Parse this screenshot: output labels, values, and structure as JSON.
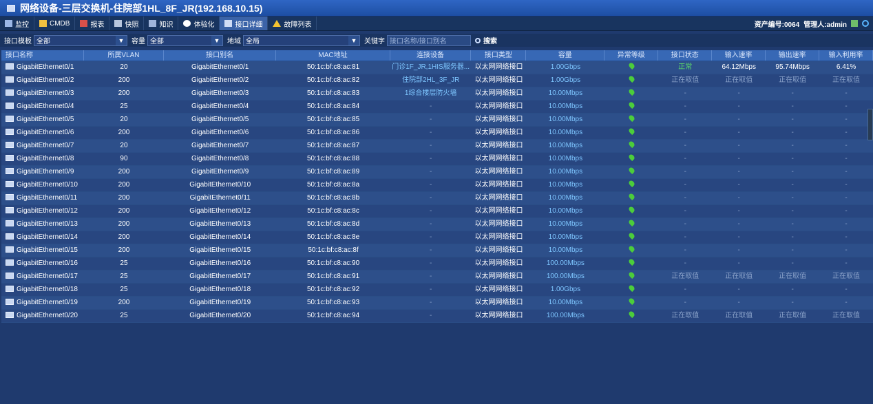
{
  "window": {
    "title": "网络设备-三层交换机-住院部1HL_8F_JR(192.168.10.15)"
  },
  "tabs": [
    {
      "label": "监控",
      "icon": "monitor-icon"
    },
    {
      "label": "CMDB",
      "icon": "cmdb-icon"
    },
    {
      "label": "报表",
      "icon": "report-icon"
    },
    {
      "label": "快照",
      "icon": "snapshot-icon"
    },
    {
      "label": "知识",
      "icon": "knowledge-icon"
    },
    {
      "label": "体验化",
      "icon": "experience-icon"
    },
    {
      "label": "接口详细",
      "icon": "interface-icon",
      "active": true
    },
    {
      "label": "故障列表",
      "icon": "warning-icon"
    }
  ],
  "header_right": {
    "asset_label": "资产编号:0064",
    "admin_label": "管理人:admin"
  },
  "filters": {
    "template_label": "接口模板",
    "template_value": "全部",
    "capacity_label": "容量",
    "capacity_value": "全部",
    "region_label": "地域",
    "region_value": "全局",
    "keyword_label": "关键字",
    "keyword_placeholder": "接口名称/接口别名",
    "search_label": "搜索"
  },
  "columns": [
    "接口名称",
    "所属VLAN",
    "接口别名",
    "MAC地址",
    "连接设备",
    "接口类型",
    "容量",
    "异常等级",
    "接口状态",
    "输入速率",
    "输出速率",
    "输入利用率"
  ],
  "rows": [
    {
      "name": "GigabitEthernet0/1",
      "vlan": "20",
      "alias": "GigabitEthernet0/1",
      "mac": "50:1c:bf:c8:ac:81",
      "device": "门诊1F_JR,1HIS服务器...",
      "type": "以太网网络接口",
      "cap": "1.00Gbps",
      "status": "正常",
      "in": "64.12Mbps",
      "out": "95.74Mbps",
      "util": "6.41%"
    },
    {
      "name": "GigabitEthernet0/2",
      "vlan": "200",
      "alias": "GigabitEthernet0/2",
      "mac": "50:1c:bf:c8:ac:82",
      "device": "住院部2HL_3F_JR",
      "type": "以太网网络接口",
      "cap": "1.00Gbps",
      "status": "正在取值",
      "in": "正在取值",
      "out": "正在取值",
      "util": "正在取值"
    },
    {
      "name": "GigabitEthernet0/3",
      "vlan": "200",
      "alias": "GigabitEthernet0/3",
      "mac": "50:1c:bf:c8:ac:83",
      "device": "1综合楼层防火墙",
      "type": "以太网网络接口",
      "cap": "10.00Mbps",
      "status": "-",
      "in": "-",
      "out": "-",
      "util": "-"
    },
    {
      "name": "GigabitEthernet0/4",
      "vlan": "25",
      "alias": "GigabitEthernet0/4",
      "mac": "50:1c:bf:c8:ac:84",
      "device": "-",
      "type": "以太网网络接口",
      "cap": "10.00Mbps",
      "status": "-",
      "in": "-",
      "out": "-",
      "util": "-"
    },
    {
      "name": "GigabitEthernet0/5",
      "vlan": "20",
      "alias": "GigabitEthernet0/5",
      "mac": "50:1c:bf:c8:ac:85",
      "device": "-",
      "type": "以太网网络接口",
      "cap": "10.00Mbps",
      "status": "-",
      "in": "-",
      "out": "-",
      "util": "-"
    },
    {
      "name": "GigabitEthernet0/6",
      "vlan": "200",
      "alias": "GigabitEthernet0/6",
      "mac": "50:1c:bf:c8:ac:86",
      "device": "-",
      "type": "以太网网络接口",
      "cap": "10.00Mbps",
      "status": "-",
      "in": "-",
      "out": "-",
      "util": "-"
    },
    {
      "name": "GigabitEthernet0/7",
      "vlan": "20",
      "alias": "GigabitEthernet0/7",
      "mac": "50:1c:bf:c8:ac:87",
      "device": "-",
      "type": "以太网网络接口",
      "cap": "10.00Mbps",
      "status": "-",
      "in": "-",
      "out": "-",
      "util": "-"
    },
    {
      "name": "GigabitEthernet0/8",
      "vlan": "90",
      "alias": "GigabitEthernet0/8",
      "mac": "50:1c:bf:c8:ac:88",
      "device": "-",
      "type": "以太网网络接口",
      "cap": "10.00Mbps",
      "status": "-",
      "in": "-",
      "out": "-",
      "util": "-"
    },
    {
      "name": "GigabitEthernet0/9",
      "vlan": "200",
      "alias": "GigabitEthernet0/9",
      "mac": "50:1c:bf:c8:ac:89",
      "device": "-",
      "type": "以太网网络接口",
      "cap": "10.00Mbps",
      "status": "-",
      "in": "-",
      "out": "-",
      "util": "-"
    },
    {
      "name": "GigabitEthernet0/10",
      "vlan": "200",
      "alias": "GigabitEthernet0/10",
      "mac": "50:1c:bf:c8:ac:8a",
      "device": "-",
      "type": "以太网网络接口",
      "cap": "10.00Mbps",
      "status": "-",
      "in": "-",
      "out": "-",
      "util": "-"
    },
    {
      "name": "GigabitEthernet0/11",
      "vlan": "200",
      "alias": "GigabitEthernet0/11",
      "mac": "50:1c:bf:c8:ac:8b",
      "device": "-",
      "type": "以太网网络接口",
      "cap": "10.00Mbps",
      "status": "-",
      "in": "-",
      "out": "-",
      "util": "-"
    },
    {
      "name": "GigabitEthernet0/12",
      "vlan": "200",
      "alias": "GigabitEthernet0/12",
      "mac": "50:1c:bf:c8:ac:8c",
      "device": "-",
      "type": "以太网网络接口",
      "cap": "10.00Mbps",
      "status": "-",
      "in": "-",
      "out": "-",
      "util": "-"
    },
    {
      "name": "GigabitEthernet0/13",
      "vlan": "200",
      "alias": "GigabitEthernet0/13",
      "mac": "50:1c:bf:c8:ac:8d",
      "device": "-",
      "type": "以太网网络接口",
      "cap": "10.00Mbps",
      "status": "-",
      "in": "-",
      "out": "-",
      "util": "-"
    },
    {
      "name": "GigabitEthernet0/14",
      "vlan": "200",
      "alias": "GigabitEthernet0/14",
      "mac": "50:1c:bf:c8:ac:8e",
      "device": "-",
      "type": "以太网网络接口",
      "cap": "10.00Mbps",
      "status": "-",
      "in": "-",
      "out": "-",
      "util": "-"
    },
    {
      "name": "GigabitEthernet0/15",
      "vlan": "200",
      "alias": "GigabitEthernet0/15",
      "mac": "50:1c:bf:c8:ac:8f",
      "device": "-",
      "type": "以太网网络接口",
      "cap": "10.00Mbps",
      "status": "-",
      "in": "-",
      "out": "-",
      "util": "-"
    },
    {
      "name": "GigabitEthernet0/16",
      "vlan": "25",
      "alias": "GigabitEthernet0/16",
      "mac": "50:1c:bf:c8:ac:90",
      "device": "-",
      "type": "以太网网络接口",
      "cap": "100.00Mbps",
      "status": "-",
      "in": "-",
      "out": "-",
      "util": "-"
    },
    {
      "name": "GigabitEthernet0/17",
      "vlan": "25",
      "alias": "GigabitEthernet0/17",
      "mac": "50:1c:bf:c8:ac:91",
      "device": "-",
      "type": "以太网网络接口",
      "cap": "100.00Mbps",
      "status": "正在取值",
      "in": "正在取值",
      "out": "正在取值",
      "util": "正在取值"
    },
    {
      "name": "GigabitEthernet0/18",
      "vlan": "25",
      "alias": "GigabitEthernet0/18",
      "mac": "50:1c:bf:c8:ac:92",
      "device": "-",
      "type": "以太网网络接口",
      "cap": "1.00Gbps",
      "status": "-",
      "in": "-",
      "out": "-",
      "util": "-"
    },
    {
      "name": "GigabitEthernet0/19",
      "vlan": "200",
      "alias": "GigabitEthernet0/19",
      "mac": "50:1c:bf:c8:ac:93",
      "device": "-",
      "type": "以太网网络接口",
      "cap": "10.00Mbps",
      "status": "-",
      "in": "-",
      "out": "-",
      "util": "-"
    },
    {
      "name": "GigabitEthernet0/20",
      "vlan": "25",
      "alias": "GigabitEthernet0/20",
      "mac": "50:1c:bf:c8:ac:94",
      "device": "-",
      "type": "以太网网络接口",
      "cap": "100.00Mbps",
      "status": "正在取值",
      "in": "正在取值",
      "out": "正在取值",
      "util": "正在取值"
    }
  ]
}
